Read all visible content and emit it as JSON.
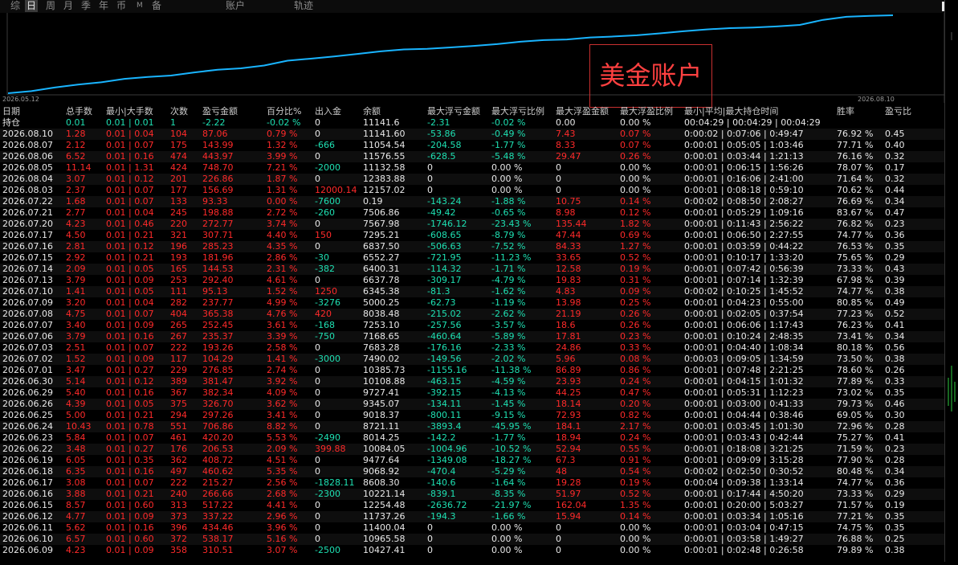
{
  "toolbar": {
    "period_tabs": [
      "综",
      "日",
      "周",
      "月",
      "季",
      "年",
      "币",
      "M",
      "备"
    ],
    "active_tab": "日",
    "section_account": "账户",
    "section_track": "轨迹"
  },
  "chart": {
    "start_label": "2026.05.12",
    "end_label": "2026.08.10",
    "watermark": "美金账户",
    "line_color": "#19b4ff"
  },
  "columns": [
    "日期",
    "总手数",
    "最小|大手数",
    "次数",
    "盈亏金额",
    "百分比%",
    "出入金",
    "余额",
    "最大浮亏金额",
    "最大浮亏比例",
    "最大浮盈金额",
    "最大浮盈比例",
    "最小|平均|最大持仓时间",
    "胜率",
    "盈亏比"
  ],
  "holding_row": {
    "label": "持仓",
    "lots": "0.01",
    "minmax": "0.01 | 0.01",
    "count": "1",
    "pnl": "-2.22",
    "pct": "-0.02 %",
    "flow": "0",
    "balance": "11141.6",
    "maxloss": "-2.31",
    "maxloss_pct": "-0.02 %",
    "maxgain": "0.00",
    "maxgain_pct": "0.00 %",
    "hold": "00:04:29 | 00:04:29 | 00:04:29",
    "win": "",
    "ratio": ""
  },
  "rows": [
    [
      "2026.08.10",
      "1.28",
      "0.01 | 0.04",
      "104",
      "87.06",
      "0.79 %",
      "0",
      "11141.60",
      "-53.86",
      "-0.49 %",
      "7.43",
      "0.07 %",
      "0:00:02 | 0:07:06 | 0:49:47",
      "76.92 %",
      "0.45"
    ],
    [
      "2026.08.07",
      "2.12",
      "0.01 | 0.07",
      "175",
      "143.99",
      "1.32 %",
      "-666",
      "11054.54",
      "-204.58",
      "-1.77 %",
      "8.33",
      "0.07 %",
      "0:00:01 | 0:05:05 | 1:03:46",
      "77.71 %",
      "0.40"
    ],
    [
      "2026.08.06",
      "6.52",
      "0.01 | 0.16",
      "474",
      "443.97",
      "3.99 %",
      "0",
      "11576.55",
      "-628.5",
      "-5.48 %",
      "29.47",
      "0.26 %",
      "0:00:01 | 0:03:44 | 1:21:13",
      "76.16 %",
      "0.32"
    ],
    [
      "2026.08.05",
      "11.14",
      "0.01 | 1.31",
      "424",
      "748.70",
      "7.21 %",
      "-2000",
      "11132.58",
      "0",
      "0.00 %",
      "0",
      "0.00 %",
      "0:00:01 | 0:06:15 | 1:56:26",
      "78.07 %",
      "0.17"
    ],
    [
      "2026.08.04",
      "3.07",
      "0.01 | 0.12",
      "201",
      "226.86",
      "1.87 %",
      "0",
      "12383.88",
      "0",
      "0.00 %",
      "0",
      "0.00 %",
      "0:00:01 | 0:16:06 | 2:41:00",
      "71.64 %",
      "0.32"
    ],
    [
      "2026.08.03",
      "2.37",
      "0.01 | 0.07",
      "177",
      "156.69",
      "1.31 %",
      "12000.14",
      "12157.02",
      "0",
      "0.00 %",
      "0",
      "0.00 %",
      "0:00:01 | 0:08:18 | 0:59:10",
      "70.62 %",
      "0.44"
    ],
    [
      "2026.07.22",
      "1.68",
      "0.01 | 0.07",
      "133",
      "93.33",
      "0.00 %",
      "-7600",
      "0.19",
      "-143.24",
      "-1.88 %",
      "10.75",
      "0.14 %",
      "0:00:02 | 0:08:50 | 2:08:27",
      "76.69 %",
      "0.34"
    ],
    [
      "2026.07.21",
      "2.77",
      "0.01 | 0.04",
      "245",
      "198.88",
      "2.72 %",
      "-260",
      "7506.86",
      "-49.42",
      "-0.65 %",
      "8.98",
      "0.12 %",
      "0:00:01 | 0:05:29 | 1:09:16",
      "83.67 %",
      "0.47"
    ],
    [
      "2026.07.20",
      "4.23",
      "0.01 | 0.46",
      "220",
      "272.77",
      "3.74 %",
      "0",
      "7567.98",
      "-1746.12",
      "-23.43 %",
      "135.44",
      "1.82 %",
      "0:00:01 | 0:11:43 | 2:56:22",
      "76.82 %",
      "0.23"
    ],
    [
      "2026.07.17",
      "4.50",
      "0.01 | 0.21",
      "321",
      "307.71",
      "4.40 %",
      "150",
      "7295.21",
      "-608.65",
      "-8.79 %",
      "47.44",
      "0.69 %",
      "0:00:01 | 0:06:50 | 2:27:55",
      "74.77 %",
      "0.36"
    ],
    [
      "2026.07.16",
      "2.81",
      "0.01 | 0.12",
      "196",
      "285.23",
      "4.35 %",
      "0",
      "6837.50",
      "-506.63",
      "-7.52 %",
      "84.33",
      "1.27 %",
      "0:00:01 | 0:03:59 | 0:44:22",
      "76.53 %",
      "0.35"
    ],
    [
      "2026.07.15",
      "2.92",
      "0.01 | 0.21",
      "193",
      "181.96",
      "2.86 %",
      "-30",
      "6552.27",
      "-721.95",
      "-11.23 %",
      "33.65",
      "0.52 %",
      "0:00:01 | 0:10:17 | 1:33:20",
      "75.65 %",
      "0.29"
    ],
    [
      "2026.07.14",
      "2.09",
      "0.01 | 0.05",
      "165",
      "144.53",
      "2.31 %",
      "-382",
      "6400.31",
      "-114.32",
      "-1.71 %",
      "12.58",
      "0.19 %",
      "0:00:01 | 0:07:42 | 0:56:39",
      "73.33 %",
      "0.43"
    ],
    [
      "2026.07.13",
      "3.79",
      "0.01 | 0.09",
      "253",
      "292.40",
      "4.61 %",
      "0",
      "6637.78",
      "-309.17",
      "-4.79 %",
      "19.83",
      "0.31 %",
      "0:00:01 | 0:07:14 | 1:32:39",
      "67.98 %",
      "0.39"
    ],
    [
      "2026.07.10",
      "1.41",
      "0.01 | 0.05",
      "111",
      "95.13",
      "1.52 %",
      "1250",
      "6345.38",
      "-81.3",
      "-1.62 %",
      "4.83",
      "0.09 %",
      "0:00:02 | 0:10:25 | 1:45:52",
      "74.77 %",
      "0.38"
    ],
    [
      "2026.07.09",
      "3.20",
      "0.01 | 0.04",
      "282",
      "237.77",
      "4.99 %",
      "-3276",
      "5000.25",
      "-62.73",
      "-1.19 %",
      "13.98",
      "0.25 %",
      "0:00:01 | 0:04:23 | 0:55:00",
      "80.85 %",
      "0.49"
    ],
    [
      "2026.07.08",
      "4.75",
      "0.01 | 0.07",
      "404",
      "365.38",
      "4.76 %",
      "420",
      "8038.48",
      "-215.02",
      "-2.62 %",
      "21.19",
      "0.26 %",
      "0:00:01 | 0:02:05 | 0:37:54",
      "77.23 %",
      "0.52"
    ],
    [
      "2026.07.07",
      "3.40",
      "0.01 | 0.09",
      "265",
      "252.45",
      "3.61 %",
      "-168",
      "7253.10",
      "-257.56",
      "-3.57 %",
      "18.6",
      "0.26 %",
      "0:00:01 | 0:06:06 | 1:17:43",
      "76.23 %",
      "0.41"
    ],
    [
      "2026.07.06",
      "3.79",
      "0.01 | 0.16",
      "267",
      "235.37",
      "3.39 %",
      "-750",
      "7168.65",
      "-460.64",
      "-5.89 %",
      "17.81",
      "0.23 %",
      "0:00:01 | 0:10:24 | 2:48:35",
      "73.41 %",
      "0.34"
    ],
    [
      "2026.07.03",
      "2.51",
      "0.01 | 0.07",
      "222",
      "193.26",
      "2.58 %",
      "0",
      "7683.28",
      "-176.16",
      "-2.33 %",
      "24.86",
      "0.33 %",
      "0:00:01 | 0:04:40 | 1:08:34",
      "80.18 %",
      "0.56"
    ],
    [
      "2026.07.02",
      "1.52",
      "0.01 | 0.09",
      "117",
      "104.29",
      "1.41 %",
      "-3000",
      "7490.02",
      "-149.56",
      "-2.02 %",
      "5.96",
      "0.08 %",
      "0:00:03 | 0:09:05 | 1:34:59",
      "73.50 %",
      "0.38"
    ],
    [
      "2026.07.01",
      "3.47",
      "0.01 | 0.27",
      "229",
      "276.85",
      "2.74 %",
      "0",
      "10385.73",
      "-1155.16",
      "-11.38 %",
      "86.89",
      "0.86 %",
      "0:00:01 | 0:07:48 | 2:21:25",
      "78.60 %",
      "0.26"
    ],
    [
      "2026.06.30",
      "5.14",
      "0.01 | 0.12",
      "389",
      "381.47",
      "3.92 %",
      "0",
      "10108.88",
      "-463.15",
      "-4.59 %",
      "23.93",
      "0.24 %",
      "0:00:01 | 0:04:15 | 1:01:32",
      "77.89 %",
      "0.33"
    ],
    [
      "2026.06.29",
      "5.40",
      "0.01 | 0.16",
      "367",
      "382.34",
      "4.09 %",
      "0",
      "9727.41",
      "-392.15",
      "-4.13 %",
      "44.25",
      "0.47 %",
      "0:00:01 | 0:05:31 | 1:12:23",
      "73.02 %",
      "0.35"
    ],
    [
      "2026.06.26",
      "4.39",
      "0.01 | 0.05",
      "375",
      "326.70",
      "3.62 %",
      "0",
      "9345.07",
      "-134.11",
      "-1.45 %",
      "18.14",
      "0.20 %",
      "0:00:01 | 0:03:00 | 0:41:33",
      "79.73 %",
      "0.46"
    ],
    [
      "2026.06.25",
      "5.00",
      "0.01 | 0.21",
      "294",
      "297.26",
      "3.41 %",
      "0",
      "9018.37",
      "-800.11",
      "-9.15 %",
      "72.93",
      "0.82 %",
      "0:00:01 | 0:04:44 | 0:38:46",
      "69.05 %",
      "0.30"
    ],
    [
      "2026.06.24",
      "10.43",
      "0.01 | 0.78",
      "551",
      "706.86",
      "8.82 %",
      "0",
      "8721.11",
      "-3893.4",
      "-45.95 %",
      "184.1",
      "2.17 %",
      "0:00:01 | 0:03:45 | 1:01:30",
      "72.96 %",
      "0.28"
    ],
    [
      "2026.06.23",
      "5.84",
      "0.01 | 0.07",
      "461",
      "420.20",
      "5.53 %",
      "-2490",
      "8014.25",
      "-142.2",
      "-1.77 %",
      "18.94",
      "0.24 %",
      "0:00:01 | 0:03:43 | 0:42:44",
      "75.27 %",
      "0.41"
    ],
    [
      "2026.06.22",
      "3.48",
      "0.01 | 0.27",
      "176",
      "206.53",
      "2.09 %",
      "399.88",
      "10084.05",
      "-1004.96",
      "-10.52 %",
      "52.94",
      "0.55 %",
      "0:00:01 | 0:18:08 | 3:21:25",
      "71.59 %",
      "0.23"
    ],
    [
      "2026.06.19",
      "6.05",
      "0.01 | 0.35",
      "362",
      "408.72",
      "4.51 %",
      "0",
      "9477.64",
      "-1349.08",
      "-18.27 %",
      "67.3",
      "0.91 %",
      "0:00:01 | 0:09:09 | 3:15:28",
      "77.90 %",
      "0.28"
    ],
    [
      "2026.06.18",
      "6.35",
      "0.01 | 0.16",
      "497",
      "460.62",
      "5.35 %",
      "0",
      "9068.92",
      "-470.4",
      "-5.29 %",
      "48",
      "0.54 %",
      "0:00:02 | 0:02:50 | 0:30:52",
      "80.48 %",
      "0.34"
    ],
    [
      "2026.06.17",
      "3.08",
      "0.01 | 0.07",
      "222",
      "215.27",
      "2.56 %",
      "-1828.11",
      "8608.30",
      "-140.6",
      "-1.64 %",
      "19.28",
      "0.19 %",
      "0:00:04 | 0:09:38 | 1:33:14",
      "74.77 %",
      "0.36"
    ],
    [
      "2026.06.16",
      "3.88",
      "0.01 | 0.21",
      "240",
      "266.66",
      "2.68 %",
      "-2300",
      "10221.14",
      "-839.1",
      "-8.35 %",
      "51.97",
      "0.52 %",
      "0:00:01 | 0:17:44 | 4:50:20",
      "73.33 %",
      "0.29"
    ],
    [
      "2026.06.15",
      "8.57",
      "0.01 | 0.60",
      "313",
      "517.22",
      "4.41 %",
      "0",
      "12254.48",
      "-2636.72",
      "-21.97 %",
      "162.04",
      "1.35 %",
      "0:00:01 | 0:20:00 | 5:03:27",
      "71.57 %",
      "0.19"
    ],
    [
      "2026.06.12",
      "4.77",
      "0.01 | 0.09",
      "373",
      "337.22",
      "2.96 %",
      "0",
      "11737.26",
      "-194.3",
      "-1.66 %",
      "15.94",
      "0.14 %",
      "0:00:01 | 0:03:34 | 1:05:16",
      "77.21 %",
      "0.35"
    ],
    [
      "2026.06.11",
      "5.62",
      "0.01 | 0.16",
      "396",
      "434.46",
      "3.96 %",
      "0",
      "11400.04",
      "0",
      "0.00 %",
      "0",
      "0.00 %",
      "0:00:01 | 0:03:04 | 0:47:15",
      "74.75 %",
      "0.35"
    ],
    [
      "2026.06.10",
      "6.57",
      "0.01 | 0.60",
      "372",
      "538.17",
      "5.16 %",
      "0",
      "10965.58",
      "0",
      "0.00 %",
      "0",
      "0.00 %",
      "0:00:01 | 0:03:58 | 1:49:27",
      "76.88 %",
      "0.25"
    ],
    [
      "2026.06.09",
      "4.23",
      "0.01 | 0.09",
      "358",
      "310.51",
      "3.07 %",
      "-2500",
      "10427.41",
      "0",
      "0.00 %",
      "0",
      "0.00 %",
      "0:00:01 | 0:02:48 | 0:26:58",
      "79.89 %",
      "0.38"
    ]
  ]
}
